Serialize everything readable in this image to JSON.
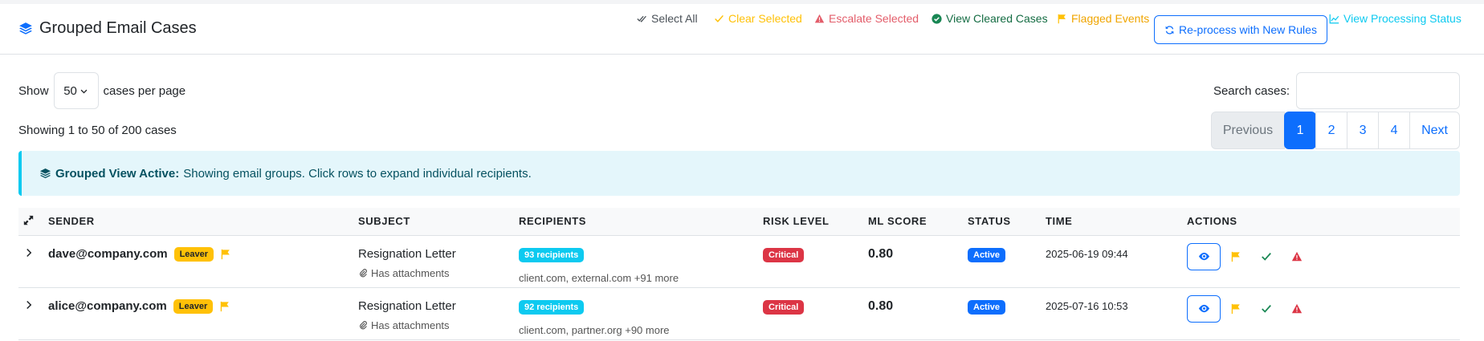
{
  "header": {
    "title": "Grouped Email Cases",
    "actions": {
      "select_all": "Select All",
      "clear_selected": "Clear Selected",
      "escalate_selected": "Escalate Selected",
      "view_cleared": "View Cleared Cases",
      "flagged_events": "Flagged Events",
      "reprocess": "Re-process with New Rules",
      "processing_status": "View Processing Status"
    }
  },
  "controls": {
    "show_label": "Show",
    "per_page_value": "50",
    "per_page_suffix": "cases per page",
    "search_label": "Search cases:",
    "search_value": "",
    "info": "Showing 1 to 50 of 200 cases"
  },
  "pagination": {
    "previous": "Previous",
    "pages": [
      "1",
      "2",
      "3",
      "4"
    ],
    "current": "1",
    "next": "Next"
  },
  "alert": {
    "strong": "Grouped View Active:",
    "text": "Showing email groups. Click rows to expand individual recipients."
  },
  "table": {
    "columns": [
      "SENDER",
      "SUBJECT",
      "RECIPIENTS",
      "RISK LEVEL",
      "ML SCORE",
      "STATUS",
      "TIME",
      "ACTIONS"
    ],
    "rows": [
      {
        "sender": "dave@company.com",
        "tag": "Leaver",
        "subject": "Resignation Letter",
        "attachment": "Has attachments",
        "recipients_badge": "93 recipients",
        "recipients_list": "client.com, external.com +91 more",
        "risk": "Critical",
        "score": "0.80",
        "status": "Active",
        "time": "2025-06-19 09:44"
      },
      {
        "sender": "alice@company.com",
        "tag": "Leaver",
        "subject": "Resignation Letter",
        "attachment": "Has attachments",
        "recipients_badge": "92 recipients",
        "recipients_list": "client.com, partner.org +90 more",
        "risk": "Critical",
        "score": "0.80",
        "status": "Active",
        "time": "2025-07-16 10:53"
      }
    ]
  },
  "colors": {
    "primary": "#0d6efd",
    "warning": "#ffc107",
    "danger": "#dc3545",
    "success": "#198754",
    "info": "#0dcaf0"
  }
}
